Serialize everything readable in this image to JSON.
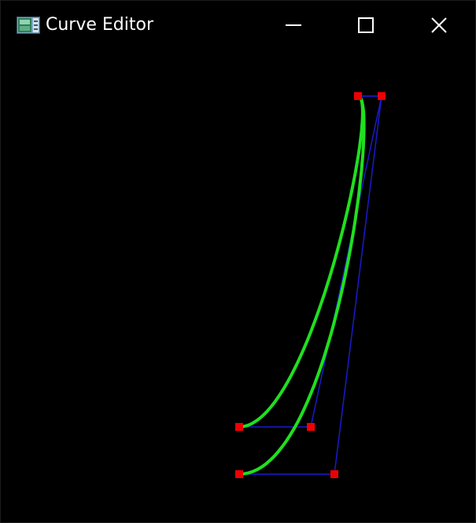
{
  "window": {
    "title": "Curve Editor",
    "icon": "app-window-icon",
    "controls": [
      "minimize-icon",
      "maximize-icon",
      "close-icon"
    ]
  },
  "colors": {
    "background": "#000000",
    "curve": "#1fe01f",
    "control_polygon": "#1a1acc",
    "control_point": "#ee0000",
    "title_text": "#ffffff"
  },
  "canvas": {
    "grid": false,
    "curve_count": 2
  }
}
